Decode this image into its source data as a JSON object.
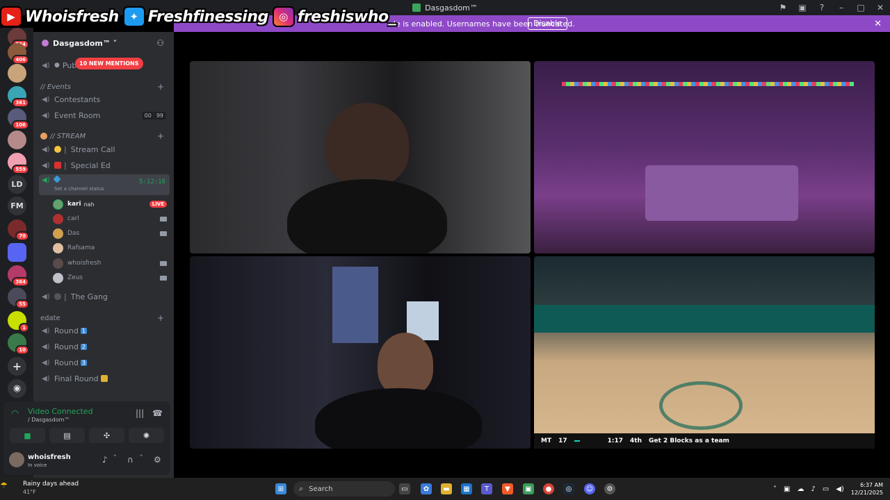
{
  "window": {
    "title": "Dasgasdom™"
  },
  "overlay": {
    "items": [
      {
        "icon": "youtube-icon",
        "text": "Whoisfresh"
      },
      {
        "icon": "twitter-icon",
        "text": "Freshfinessing"
      },
      {
        "icon": "instagram-icon",
        "text": "freshiswho_"
      }
    ]
  },
  "banner": {
    "text": "de is enabled. Usernames have been truncated.",
    "button": "Disable"
  },
  "guilds": [
    {
      "badge": "524"
    },
    {
      "badge": "406"
    },
    {
      "badge": ""
    },
    {
      "badge": "361"
    },
    {
      "badge": "106"
    },
    {
      "badge": ""
    },
    {
      "badge": "559"
    },
    {
      "label": "LD"
    },
    {
      "label": "FM"
    },
    {
      "badge": "70"
    },
    {
      "badge": ""
    },
    {
      "badge": "364"
    },
    {
      "badge": "55"
    },
    {
      "badge": "1"
    },
    {
      "badge": "10"
    }
  ],
  "server": {
    "name": "Dasgasdom™ ˅"
  },
  "mentions": "10 NEW MENTIONS",
  "channels": {
    "pub": "Pub",
    "cat_events": "// Events",
    "contestants": "Contestants",
    "event_room": "Event Room",
    "event_counts": [
      "00",
      "99"
    ],
    "cat_stream": "// STREAM",
    "stream_call": "Stream Call",
    "special_ed": "Special Ed",
    "active_status": "Set a channel status",
    "active_timer": "5:12:16",
    "the_gang": "The Gang",
    "cat_edate": "edate",
    "rounds": [
      "Round",
      "Round",
      "Round",
      "Final Round"
    ],
    "round_badges": [
      "1",
      "2",
      "3",
      ""
    ]
  },
  "voice_users": [
    {
      "name": "kari",
      "status": "nah",
      "live": "LIVE"
    },
    {
      "name": "carl"
    },
    {
      "name": "Das"
    },
    {
      "name": "Rafsama"
    },
    {
      "name": "whoisfresh"
    },
    {
      "name": "Zeus"
    }
  ],
  "voice": {
    "title": "Video Connected",
    "channel": "/ Dasgasdom™"
  },
  "user": {
    "name": "whoisfresh",
    "status": "In voice"
  },
  "game_hud": {
    "team_a": "MT",
    "score_a": "17",
    "team_b": "",
    "clock": "1:17",
    "quarter": "4th",
    "objective": "Get 2 Blocks as a team"
  },
  "taskbar": {
    "weather_title": "Rainy days ahead",
    "weather_temp": "41°F",
    "search": "Search",
    "time": "6:37 AM",
    "date": "12/21/2025"
  },
  "colors": {
    "accent": "#5865f2",
    "banner": "#8e49c7",
    "live": "#f23f43",
    "connected": "#23a55a"
  }
}
